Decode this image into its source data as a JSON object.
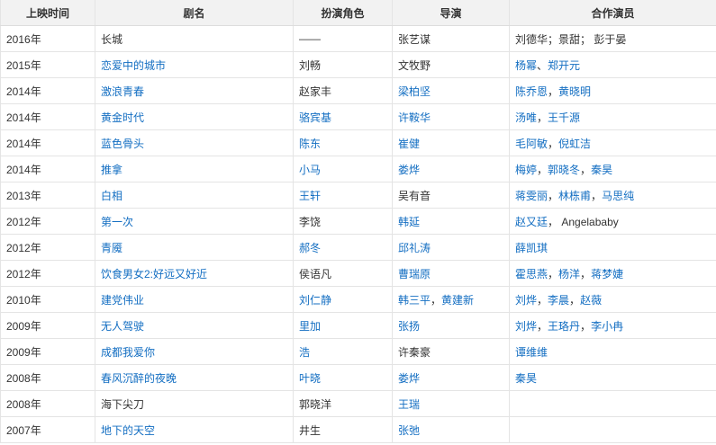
{
  "headers": [
    "上映时间",
    "剧名",
    "扮演角色",
    "导演",
    "合作演员"
  ],
  "link_color": "#136ec2",
  "rows": [
    {
      "year": "2016年",
      "title": {
        "text": "长城",
        "link": false
      },
      "role": [
        {
          "text": "——",
          "link": false
        }
      ],
      "director": [
        {
          "text": "张艺谋",
          "link": false
        }
      ],
      "costars": [
        {
          "text": "刘德华；景甜； 彭于晏",
          "link": false
        }
      ]
    },
    {
      "year": "2015年",
      "title": {
        "text": "恋爱中的城市",
        "link": true
      },
      "role": [
        {
          "text": "刘畅",
          "link": false
        }
      ],
      "director": [
        {
          "text": "文牧野",
          "link": false
        }
      ],
      "costars": [
        {
          "text": "杨幂",
          "link": true
        },
        {
          "text": "、",
          "link": false
        },
        {
          "text": "郑开元",
          "link": true
        }
      ]
    },
    {
      "year": "2014年",
      "title": {
        "text": "激浪青春",
        "link": true
      },
      "role": [
        {
          "text": "赵家丰",
          "link": false
        }
      ],
      "director": [
        {
          "text": "梁柏坚",
          "link": true
        }
      ],
      "costars": [
        {
          "text": "陈乔恩",
          "link": true
        },
        {
          "text": "，",
          "link": false
        },
        {
          "text": "黄晓明",
          "link": true
        }
      ]
    },
    {
      "year": "2014年",
      "title": {
        "text": "黄金时代",
        "link": true
      },
      "role": [
        {
          "text": "骆宾基",
          "link": true
        }
      ],
      "director": [
        {
          "text": "许鞍华",
          "link": true
        }
      ],
      "costars": [
        {
          "text": "汤唯",
          "link": true
        },
        {
          "text": "，",
          "link": false
        },
        {
          "text": "王千源",
          "link": true
        }
      ]
    },
    {
      "year": "2014年",
      "title": {
        "text": "蓝色骨头",
        "link": true
      },
      "role": [
        {
          "text": "陈东",
          "link": true
        }
      ],
      "director": [
        {
          "text": "崔健",
          "link": true
        }
      ],
      "costars": [
        {
          "text": "毛阿敏",
          "link": true
        },
        {
          "text": "，",
          "link": false
        },
        {
          "text": "倪虹洁",
          "link": true
        }
      ]
    },
    {
      "year": "2014年",
      "title": {
        "text": "推拿",
        "link": true
      },
      "role": [
        {
          "text": "小马",
          "link": true
        }
      ],
      "director": [
        {
          "text": "娄烨",
          "link": true
        }
      ],
      "costars": [
        {
          "text": "梅婷",
          "link": true
        },
        {
          "text": "，",
          "link": false
        },
        {
          "text": "郭晓冬",
          "link": true
        },
        {
          "text": "，",
          "link": false
        },
        {
          "text": "秦昊",
          "link": true
        }
      ]
    },
    {
      "year": "2013年",
      "title": {
        "text": "白相",
        "link": true
      },
      "role": [
        {
          "text": "王轩",
          "link": true
        }
      ],
      "director": [
        {
          "text": "吴有音",
          "link": false
        }
      ],
      "costars": [
        {
          "text": "蒋雯丽",
          "link": true
        },
        {
          "text": "，",
          "link": false
        },
        {
          "text": "林栋甫",
          "link": true
        },
        {
          "text": "，",
          "link": false
        },
        {
          "text": "马思纯",
          "link": true
        }
      ]
    },
    {
      "year": "2012年",
      "title": {
        "text": "第一次",
        "link": true
      },
      "role": [
        {
          "text": "李饶",
          "link": false
        }
      ],
      "director": [
        {
          "text": "韩延",
          "link": true
        }
      ],
      "costars": [
        {
          "text": "赵又廷",
          "link": true
        },
        {
          "text": "， Angelababy",
          "link": false
        }
      ]
    },
    {
      "year": "2012年",
      "title": {
        "text": "青魇",
        "link": true
      },
      "role": [
        {
          "text": "郝冬",
          "link": true
        }
      ],
      "director": [
        {
          "text": "邱礼涛",
          "link": true
        }
      ],
      "costars": [
        {
          "text": "薛凯琪",
          "link": true
        }
      ]
    },
    {
      "year": "2012年",
      "title": {
        "text": "饮食男女2:好远又好近",
        "link": true
      },
      "role": [
        {
          "text": "侯语凡",
          "link": false
        }
      ],
      "director": [
        {
          "text": "曹瑞原",
          "link": true
        }
      ],
      "costars": [
        {
          "text": "霍思燕",
          "link": true
        },
        {
          "text": "，",
          "link": false
        },
        {
          "text": "杨洋",
          "link": true
        },
        {
          "text": "，",
          "link": false
        },
        {
          "text": "蒋梦婕",
          "link": true
        }
      ]
    },
    {
      "year": "2010年",
      "title": {
        "text": "建党伟业",
        "link": true
      },
      "role": [
        {
          "text": "刘仁静",
          "link": true
        }
      ],
      "director": [
        {
          "text": "韩三平",
          "link": true
        },
        {
          "text": "，",
          "link": false
        },
        {
          "text": "黄建新",
          "link": true
        }
      ],
      "costars": [
        {
          "text": "刘烨",
          "link": true
        },
        {
          "text": "，",
          "link": false
        },
        {
          "text": "李晨",
          "link": true
        },
        {
          "text": "，",
          "link": false
        },
        {
          "text": "赵薇",
          "link": true
        }
      ]
    },
    {
      "year": "2009年",
      "title": {
        "text": "无人驾驶",
        "link": true
      },
      "role": [
        {
          "text": "里加",
          "link": true
        }
      ],
      "director": [
        {
          "text": "张扬",
          "link": true
        }
      ],
      "costars": [
        {
          "text": "刘烨",
          "link": true
        },
        {
          "text": "，",
          "link": false
        },
        {
          "text": "王珞丹",
          "link": true
        },
        {
          "text": "，",
          "link": false
        },
        {
          "text": "李小冉",
          "link": true
        }
      ]
    },
    {
      "year": "2009年",
      "title": {
        "text": "成都我爱你",
        "link": true
      },
      "role": [
        {
          "text": "浩",
          "link": true
        }
      ],
      "director": [
        {
          "text": "许秦豪",
          "link": false
        }
      ],
      "costars": [
        {
          "text": "谭维维",
          "link": true
        }
      ]
    },
    {
      "year": "2008年",
      "title": {
        "text": "春风沉醉的夜晚",
        "link": true
      },
      "role": [
        {
          "text": "叶晓",
          "link": true
        }
      ],
      "director": [
        {
          "text": "娄烨",
          "link": true
        }
      ],
      "costars": [
        {
          "text": "秦昊",
          "link": true
        }
      ]
    },
    {
      "year": "2008年",
      "title": {
        "text": "海下尖刀",
        "link": false
      },
      "role": [
        {
          "text": "郭晓洋",
          "link": false
        }
      ],
      "director": [
        {
          "text": "王瑞",
          "link": true
        }
      ],
      "costars": []
    },
    {
      "year": "2007年",
      "title": {
        "text": "地下的天空",
        "link": true
      },
      "role": [
        {
          "text": "井生",
          "link": false
        }
      ],
      "director": [
        {
          "text": "张弛",
          "link": true
        }
      ],
      "costars": []
    }
  ]
}
